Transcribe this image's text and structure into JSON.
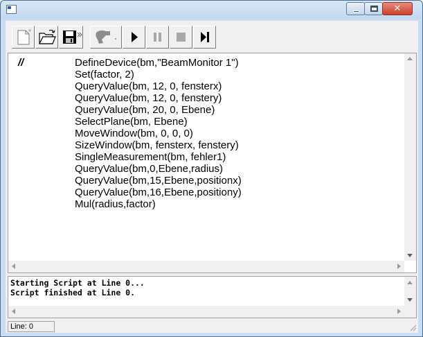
{
  "window": {
    "title": "",
    "app_icon": "app-window-icon",
    "controls": [
      "minimize-icon",
      "maximize-icon",
      "close-icon"
    ],
    "close_glyph": "✕"
  },
  "toolbar": {
    "buttons": [
      {
        "name": "new-script-button",
        "icon": "new-document-icon"
      },
      {
        "name": "open-script-button",
        "icon": "open-folder-icon"
      },
      {
        "name": "save-script-button",
        "icon": "save-disk-icon"
      },
      {
        "name": "device-button",
        "icon": "device-wizard-icon"
      },
      {
        "name": "run-button",
        "icon": "play-icon"
      },
      {
        "name": "pause-button",
        "icon": "pause-icon"
      },
      {
        "name": "stop-button",
        "icon": "stop-icon"
      },
      {
        "name": "step-button",
        "icon": "step-icon"
      }
    ]
  },
  "editor": {
    "lines": [
      {
        "label": "//",
        "text": "DefineDevice(bm,\"BeamMonitor 1\")"
      },
      {
        "label": "",
        "text": "Set(factor, 2)"
      },
      {
        "label": "",
        "text": "QueryValue(bm, 12, 0, fensterx)"
      },
      {
        "label": "",
        "text": "QueryValue(bm, 12, 0, fenstery)"
      },
      {
        "label": "",
        "text": "QueryValue(bm, 20, 0, Ebene)"
      },
      {
        "label": "",
        "text": "SelectPlane(bm, Ebene)"
      },
      {
        "label": "",
        "text": "MoveWindow(bm, 0, 0, 0)"
      },
      {
        "label": "",
        "text": "SizeWindow(bm, fensterx, fenstery)"
      },
      {
        "label": "",
        "text": "SingleMeasurement(bm, fehler1)"
      },
      {
        "label": "",
        "text": "QueryValue(bm,0,Ebene,radius)"
      },
      {
        "label": "",
        "text": "QueryValue(bm,15,Ebene,positionx)"
      },
      {
        "label": "",
        "text": "QueryValue(bm,16,Ebene,positiony)"
      },
      {
        "label": "",
        "text": "Mul(radius,factor)"
      }
    ]
  },
  "output": {
    "lines": [
      "Starting Script at Line 0...",
      "Script finished at Line 0."
    ]
  },
  "status": {
    "line_label": "Line: 0"
  },
  "colors": {
    "frame": "#c9dcf1",
    "close_button": "#c9402c",
    "toolbar_face": "#f0f0f0"
  }
}
